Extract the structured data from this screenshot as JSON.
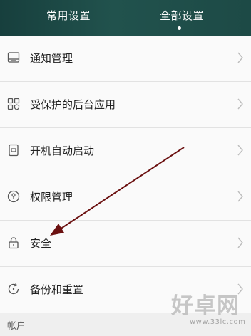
{
  "tabs": [
    {
      "label": "常用设置"
    },
    {
      "label": "全部设置"
    }
  ],
  "items": [
    {
      "label": "通知管理",
      "icon": "notification-tray-icon"
    },
    {
      "label": "受保护的后台应用",
      "icon": "protected-apps-icon"
    },
    {
      "label": "开机自动启动",
      "icon": "auto-start-icon"
    },
    {
      "label": "权限管理",
      "icon": "permission-icon"
    },
    {
      "label": "安全",
      "icon": "lock-icon"
    },
    {
      "label": "备份和重置",
      "icon": "backup-reset-icon"
    }
  ],
  "section_header": "帐户",
  "watermark": {
    "text": "好卓网",
    "url": "www.33lc.com"
  },
  "annotation_color": "#6b1010"
}
